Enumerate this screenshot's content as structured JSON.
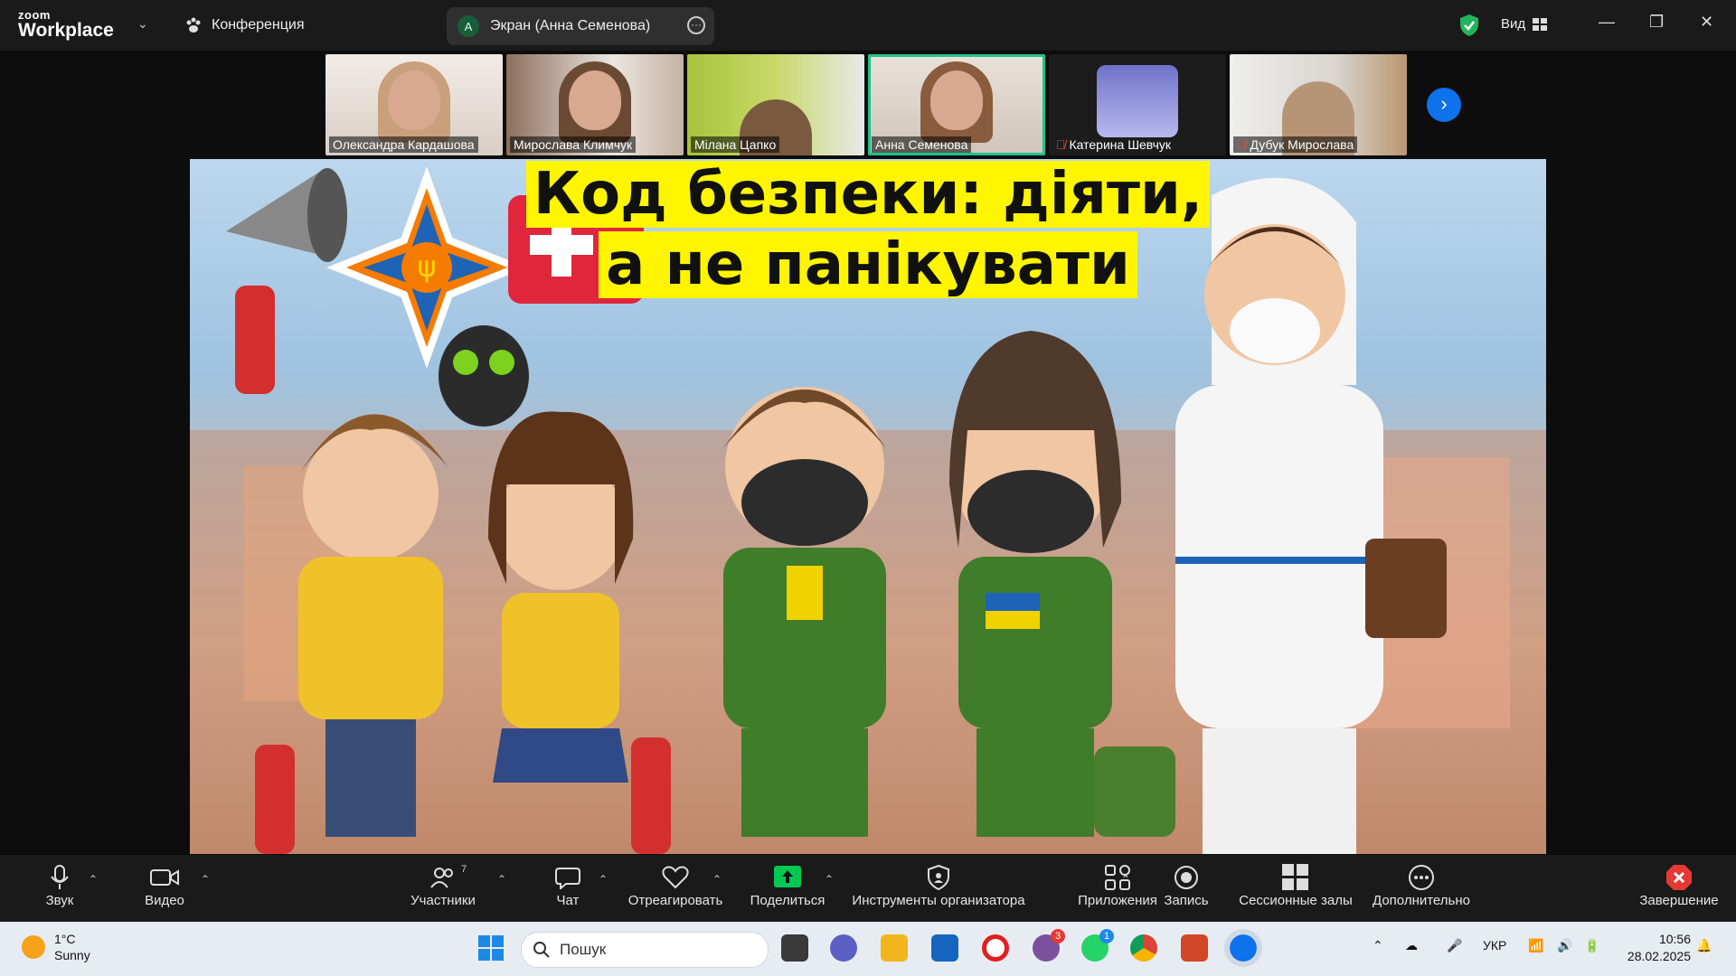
{
  "app": {
    "logo_top": "zoom",
    "logo_bottom": "Workplace",
    "meeting_label": "Конференция"
  },
  "share": {
    "avatar_letter": "A",
    "label": "Экран (Анна Семенова)"
  },
  "view": {
    "label": "Вид"
  },
  "participants": [
    {
      "name": "Олександра Кардашова",
      "muted": false,
      "active": false
    },
    {
      "name": "Мирослава Климчук",
      "muted": false,
      "active": false
    },
    {
      "name": "Мілана Цапко",
      "muted": false,
      "active": false
    },
    {
      "name": "Анна Семенова",
      "muted": false,
      "active": true
    },
    {
      "name": "Катерина Шевчук",
      "muted": true,
      "active": false
    },
    {
      "name": "Дубук Мирослава",
      "muted": true,
      "active": false
    }
  ],
  "slide": {
    "title_line1": "Код безпеки: діяти,",
    "title_line2": "а не панікувати"
  },
  "toolbar": {
    "audio": "Звук",
    "video": "Видео",
    "participants": "Участники",
    "participants_count": "7",
    "chat": "Чат",
    "react": "Отреагировать",
    "share": "Поделиться",
    "host_tools": "Инструменты организатора",
    "apps": "Приложения",
    "record": "Запись",
    "breakout": "Сессионные залы",
    "more": "Дополнительно",
    "end": "Завершение"
  },
  "taskbar": {
    "temp": "1°C",
    "weather": "Sunny",
    "search_placeholder": "Пошук",
    "lang": "УКР",
    "time": "10:56",
    "date": "28.02.2025",
    "badge_viber": "3",
    "badge_whatsapp": "1"
  },
  "colors": {
    "accent": "#0e72ed",
    "active_border": "#21c28a",
    "share_green": "#00c853",
    "end_red": "#e53935",
    "title_bg": "#fff500"
  }
}
